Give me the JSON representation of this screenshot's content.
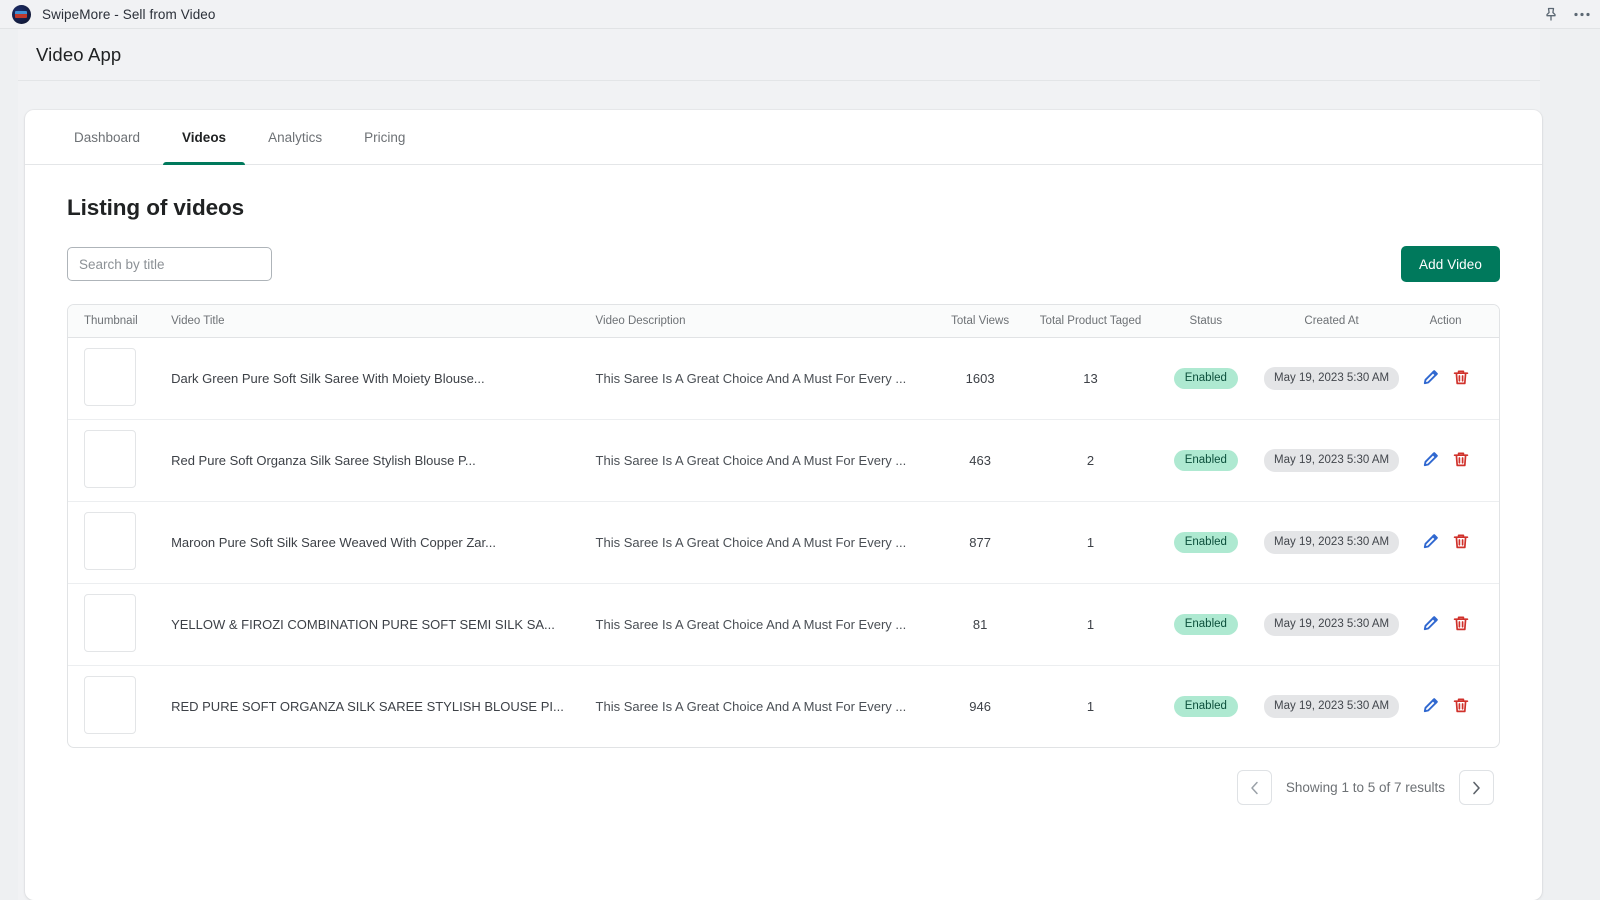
{
  "window": {
    "title": "SwipeMore - Sell from Video",
    "logo_icon": "swipemore-logo-icon",
    "pin_icon": "pin-icon",
    "more_icon": "more-horizontal-icon"
  },
  "theme": {
    "accent": "#00795C",
    "badge_status_bg": "#aee9d1",
    "badge_date_bg": "#e4e5e7",
    "edit_icon_color": "#3068d0",
    "delete_icon_color": "#d0312b"
  },
  "header": {
    "title": "Video App"
  },
  "tabs": [
    {
      "label": "Dashboard",
      "active": false
    },
    {
      "label": "Videos",
      "active": true
    },
    {
      "label": "Analytics",
      "active": false
    },
    {
      "label": "Pricing",
      "active": false
    }
  ],
  "main": {
    "listing_title": "Listing of videos",
    "search": {
      "placeholder": "Search by title",
      "value": ""
    },
    "add_button": "Add Video"
  },
  "table": {
    "columns": [
      "Thumbnail",
      "Video Title",
      "Video Description",
      "Total Views",
      "Total Product Taged",
      "Status",
      "Created At",
      "Action"
    ],
    "rows": [
      {
        "thumbnail": "dark-green-saree-thumbnail",
        "title": "Dark Green Pure Soft Silk Saree With Moiety Blouse...",
        "description": "This Saree Is A Great Choice And A Must For Every ...",
        "total_views": "1603",
        "total_product_tagged": "13",
        "status": "Enabled",
        "created_at": "May 19, 2023 5:30 AM",
        "edit_icon": "pencil-icon",
        "delete_icon": "trash-icon"
      },
      {
        "thumbnail": "red-organza-saree-thumbnail",
        "title": "Red Pure Soft Organza Silk Saree Stylish Blouse P...",
        "description": "This Saree Is A Great Choice And A Must For Every ...",
        "total_views": "463",
        "total_product_tagged": "2",
        "status": "Enabled",
        "created_at": "May 19, 2023 5:30 AM",
        "edit_icon": "pencil-icon",
        "delete_icon": "trash-icon"
      },
      {
        "thumbnail": "maroon-silk-saree-thumbnail",
        "title": "Maroon Pure Soft Silk Saree Weaved With Copper Zar...",
        "description": "This Saree Is A Great Choice And A Must For Every ...",
        "total_views": "877",
        "total_product_tagged": "1",
        "status": "Enabled",
        "created_at": "May 19, 2023 5:30 AM",
        "edit_icon": "pencil-icon",
        "delete_icon": "trash-icon"
      },
      {
        "thumbnail": "yellow-firozi-saree-thumbnail",
        "title": "YELLOW & FIROZI COMBINATION PURE SOFT SEMI SILK SA...",
        "description": "This Saree Is A Great Choice And A Must For Every ...",
        "total_views": "81",
        "total_product_tagged": "1",
        "status": "Enabled",
        "created_at": "May 19, 2023 5:30 AM",
        "edit_icon": "pencil-icon",
        "delete_icon": "trash-icon"
      },
      {
        "thumbnail": "red-organza-stylish-saree-thumbnail",
        "title": "RED PURE SOFT ORGANZA SILK SAREE STYLISH BLOUSE PI...",
        "description": "This Saree Is A Great Choice And A Must For Every ...",
        "total_views": "946",
        "total_product_tagged": "1",
        "status": "Enabled",
        "created_at": "May 19, 2023 5:30 AM",
        "edit_icon": "pencil-icon",
        "delete_icon": "trash-icon"
      }
    ]
  },
  "pagination": {
    "prev_icon": "chevron-left-icon",
    "next_icon": "chevron-right-icon",
    "info": "Showing 1 to 5 of 7 results"
  }
}
